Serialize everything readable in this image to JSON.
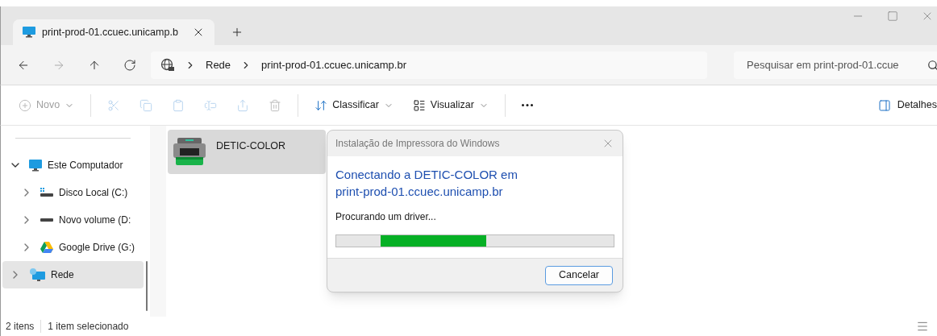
{
  "tabs": [
    {
      "label": "print-prod-01.ccuec.unicamp.b",
      "selected": true
    }
  ],
  "breadcrumb": [
    "Rede",
    "print-prod-01.ccuec.unicamp.br"
  ],
  "search": {
    "placeholder": "Pesquisar em print-prod-01.ccue"
  },
  "toolbar": [
    {
      "kind": "new",
      "label": "Novo",
      "disabled": true
    },
    {
      "kind": "cut",
      "disabled": true
    },
    {
      "kind": "copy",
      "disabled": true
    },
    {
      "kind": "paste",
      "disabled": true
    },
    {
      "kind": "rename",
      "disabled": true
    },
    {
      "kind": "share",
      "disabled": true
    },
    {
      "kind": "delete",
      "disabled": true
    },
    {
      "kind": "sort",
      "label": "Classificar",
      "disabled": false
    },
    {
      "kind": "view",
      "label": "Visualizar",
      "disabled": false
    },
    {
      "kind": "more",
      "disabled": false
    }
  ],
  "details_button": "Detalhes",
  "sidebar": {
    "items": [
      {
        "label": "Este Computador",
        "kind": "computer",
        "expanded": true,
        "selected": false,
        "children": [
          {
            "label": "Disco Local (C:)",
            "kind": "system-drive",
            "expanded": false,
            "selected": false
          },
          {
            "label": "Novo volume (D:",
            "kind": "drive",
            "expanded": false,
            "selected": false
          },
          {
            "label": "Google Drive (G:)",
            "kind": "cloud-drive",
            "expanded": false,
            "selected": false
          }
        ]
      },
      {
        "label": "Rede",
        "kind": "network",
        "expanded": false,
        "selected": true
      }
    ]
  },
  "files": [
    {
      "name": "DETIC-COLOR",
      "selected": true
    }
  ],
  "dialog": {
    "title": "Instalação de Impressora do Windows",
    "heading_lines": [
      "Conectando a DETIC-COLOR em",
      "print-prod-01.ccuec.unicamp.br"
    ],
    "status": "Procurando um driver...",
    "progress": {
      "level": 0.38
    },
    "buttons": [
      "Cancelar"
    ]
  },
  "status_bar": [
    "2 itens",
    "1 item selecionado"
  ]
}
